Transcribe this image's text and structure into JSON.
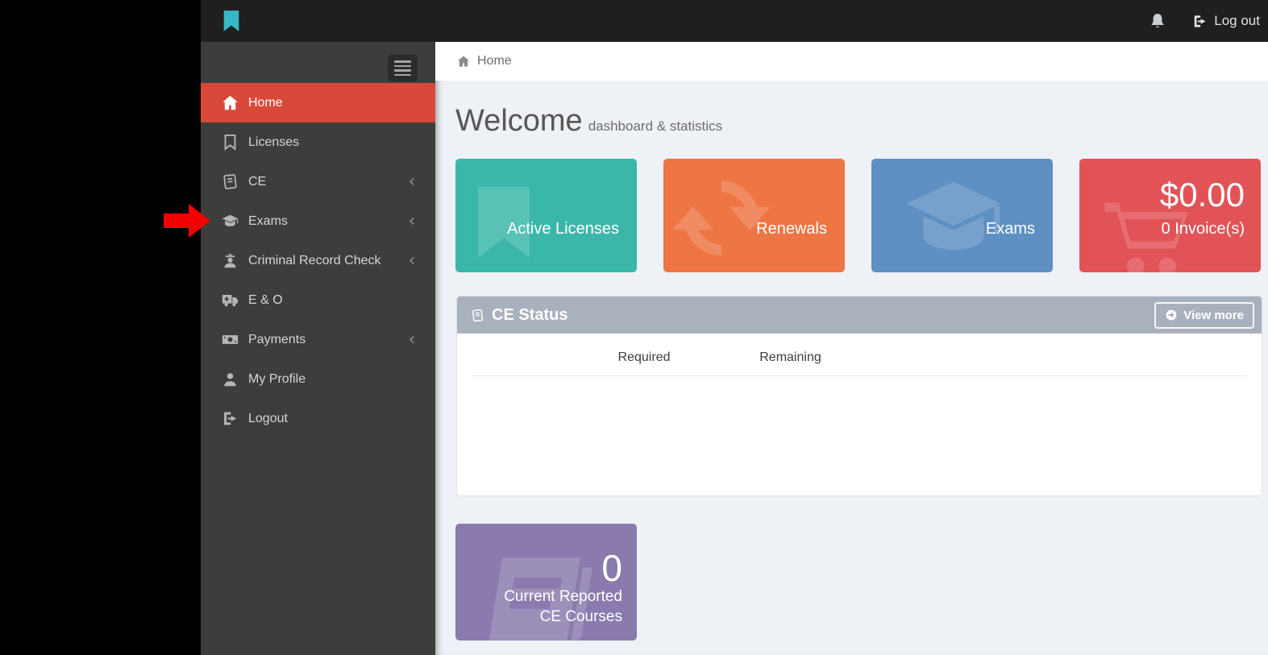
{
  "topbar": {
    "logout_label": "Log out"
  },
  "sidebar": {
    "items": [
      {
        "label": "Home",
        "icon": "home-icon",
        "active": true,
        "has_submenu": false
      },
      {
        "label": "Licenses",
        "icon": "bookmark-outline-icon",
        "active": false,
        "has_submenu": false
      },
      {
        "label": "CE",
        "icon": "book-icon",
        "active": false,
        "has_submenu": true
      },
      {
        "label": "Exams",
        "icon": "graduation-cap-icon",
        "active": false,
        "has_submenu": true
      },
      {
        "label": "Criminal Record Check",
        "icon": "user-secret-icon",
        "active": false,
        "has_submenu": true
      },
      {
        "label": "E & O",
        "icon": "ambulance-icon",
        "active": false,
        "has_submenu": false
      },
      {
        "label": "Payments",
        "icon": "money-icon",
        "active": false,
        "has_submenu": true
      },
      {
        "label": "My Profile",
        "icon": "user-icon",
        "active": false,
        "has_submenu": false
      },
      {
        "label": "Logout",
        "icon": "sign-out-icon",
        "active": false,
        "has_submenu": false
      }
    ]
  },
  "breadcrumb": {
    "home_label": "Home"
  },
  "page_header": {
    "title": "Welcome",
    "subtitle": "dashboard & statistics"
  },
  "stat_tiles": [
    {
      "label": "Active Licenses",
      "color": "#3ab7a9",
      "icon": "bookmark-icon"
    },
    {
      "label": "Renewals",
      "color": "#ee7544",
      "icon": "refresh-icon"
    },
    {
      "label": "Exams",
      "color": "#5e90c3",
      "icon": "graduation-cap-icon"
    },
    {
      "amount": "$0.00",
      "label": "0 Invoice(s)",
      "color": "#e25357",
      "icon": "shopping-cart-icon"
    }
  ],
  "ce_status_panel": {
    "title": "CE Status",
    "header_color": "#a9b1bd",
    "view_more_label": "View more",
    "columns": [
      "Required",
      "Remaining"
    ],
    "rows": []
  },
  "ce_courses_tile": {
    "count": "0",
    "label_line1": "Current Reported",
    "label_line2": "CE Courses",
    "color": "#8a7aad"
  },
  "annotation": {
    "shape": "red-arrow-right",
    "color": "#f40000",
    "points_at": "Exams"
  }
}
